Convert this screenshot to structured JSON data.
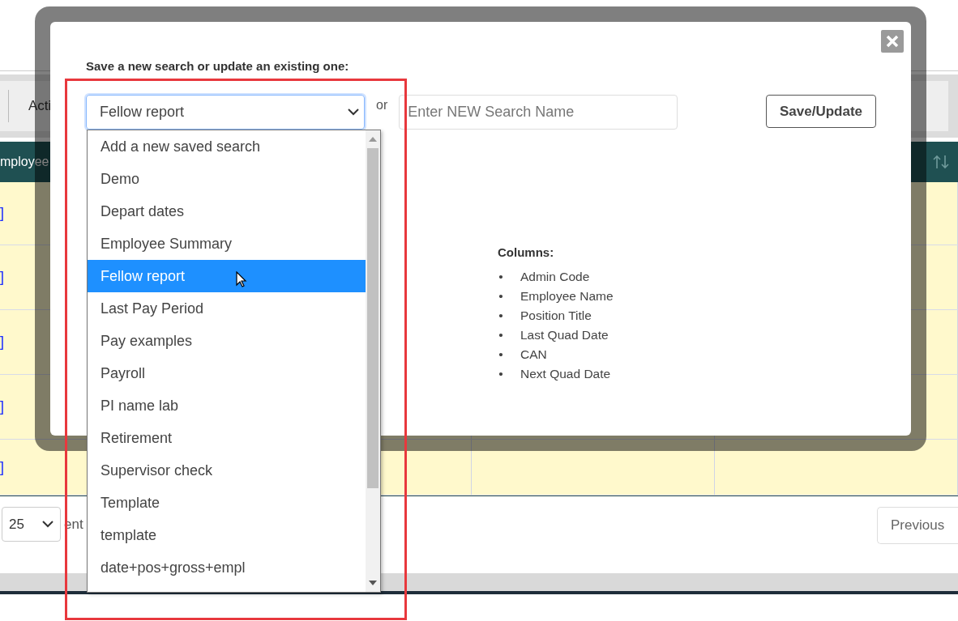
{
  "page": {
    "toolbar_text": "Acti",
    "table_header": "mployee",
    "rows": [
      {
        "link": "]"
      },
      {
        "link": "]"
      },
      {
        "link": "]"
      },
      {
        "link": "]"
      },
      {
        "link": "]"
      }
    ],
    "page_size": "25",
    "entries_text": "ent",
    "previous_button": "Previous"
  },
  "dialog": {
    "prompt": "Save a new search or update an existing one:",
    "saved_search_select": {
      "value": "Fellow report",
      "expanded": true,
      "options": [
        {
          "label": "Add a new saved search",
          "selected": false
        },
        {
          "label": "Demo",
          "selected": false
        },
        {
          "label": "Depart dates",
          "selected": false
        },
        {
          "label": "Employee Summary",
          "selected": false
        },
        {
          "label": "Fellow report",
          "selected": true
        },
        {
          "label": "Last Pay Period",
          "selected": false
        },
        {
          "label": "Pay examples",
          "selected": false
        },
        {
          "label": "Payroll",
          "selected": false
        },
        {
          "label": "PI name lab",
          "selected": false
        },
        {
          "label": "Retirement",
          "selected": false
        },
        {
          "label": "Supervisor check",
          "selected": false
        },
        {
          "label": "Template",
          "selected": false
        },
        {
          "label": "template",
          "selected": false
        },
        {
          "label": "date+pos+gross+empl",
          "selected": false
        }
      ]
    },
    "or_text": "or",
    "name_field": {
      "placeholder": "Enter NEW Search Name"
    },
    "save_button": "Save/Update",
    "columns_heading": "Columns:",
    "columns": [
      {
        "bullet": "•",
        "label": "Admin Code"
      },
      {
        "bullet": "•",
        "label": "Employee Name"
      },
      {
        "bullet": "•",
        "label": "Position Title"
      },
      {
        "bullet": "•",
        "label": "Last Quad Date"
      },
      {
        "bullet": "•",
        "label": "CAN"
      },
      {
        "bullet": "•",
        "label": "Next Quad Date"
      }
    ]
  }
}
